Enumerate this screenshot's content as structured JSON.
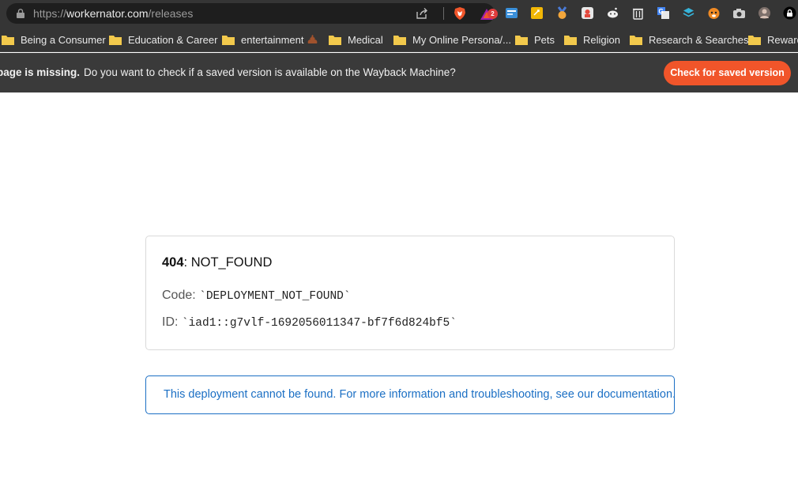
{
  "addressbar": {
    "scheme": "https://",
    "host": "workernator.com",
    "path": "/releases",
    "rewards_badge": "2"
  },
  "bookmarks": [
    {
      "label": "Being a Consumer"
    },
    {
      "label": "Education & Career"
    },
    {
      "label": "entertainment"
    },
    {
      "label": "Medical"
    },
    {
      "label": "My Online Persona/..."
    },
    {
      "label": "Pets"
    },
    {
      "label": "Religion"
    },
    {
      "label": "Research & Searches"
    },
    {
      "label": "Reward"
    }
  ],
  "extensions": [
    "news-icon",
    "sticky-note-icon",
    "medal-icon",
    "puzzle-icon",
    "reddit-icon",
    "trash-icon",
    "translate-icon",
    "layers-icon",
    "tiger-icon",
    "camera-icon",
    "avatar-icon",
    "lock-icon"
  ],
  "wayback": {
    "bold_text": "page is missing.",
    "message": "Do you want to check if a saved version is available on the Wayback Machine?",
    "button_label": "Check for saved version"
  },
  "error": {
    "status_code": "404",
    "status_text": ": NOT_FOUND",
    "code_label": "Code:",
    "code_value": "`DEPLOYMENT_NOT_FOUND`",
    "id_label": "ID:",
    "id_value": "`iad1::g7vlf-1692056011347-bf7f6d824bf5`"
  },
  "info": {
    "message": "This deployment cannot be found. For more information and troubleshooting, see our documentation."
  },
  "colors": {
    "accent_button": "#f1552a",
    "info_blue": "#1b6fc4",
    "chrome_dark": "#353535"
  }
}
